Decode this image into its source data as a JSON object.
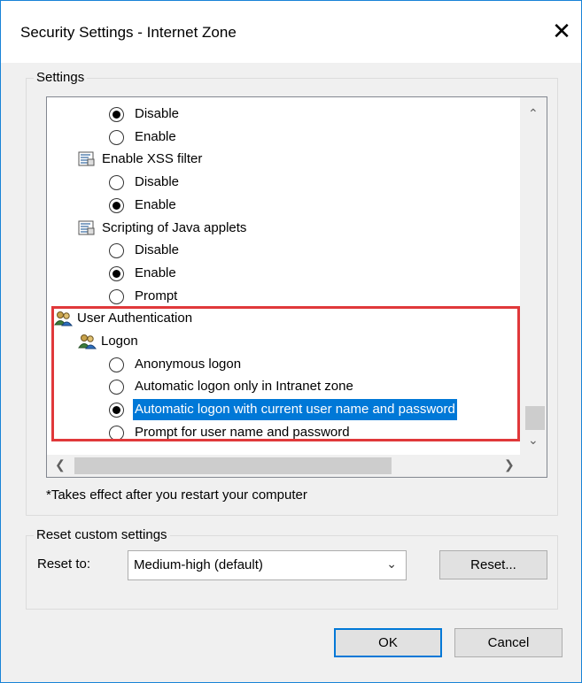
{
  "window": {
    "title": "Security Settings - Internet Zone",
    "close_glyph": "✕"
  },
  "settings_group": {
    "legend": "Settings",
    "rows": [
      {
        "kind": "radio",
        "label": "Disable",
        "checked": true
      },
      {
        "kind": "radio",
        "label": "Enable",
        "checked": false
      },
      {
        "kind": "setting",
        "label": "Enable XSS filter",
        "icon": "script-setting-icon"
      },
      {
        "kind": "radio",
        "label": "Disable",
        "checked": false
      },
      {
        "kind": "radio",
        "label": "Enable",
        "checked": true
      },
      {
        "kind": "setting",
        "label": "Scripting of Java applets",
        "icon": "script-setting-icon"
      },
      {
        "kind": "radio",
        "label": "Disable",
        "checked": false
      },
      {
        "kind": "radio",
        "label": "Enable",
        "checked": true
      },
      {
        "kind": "radio",
        "label": "Prompt",
        "checked": false
      },
      {
        "kind": "category",
        "label": "User Authentication",
        "icon": "users-icon"
      },
      {
        "kind": "subcategory",
        "label": "Logon",
        "icon": "users-icon"
      },
      {
        "kind": "radio",
        "label": "Anonymous logon",
        "checked": false
      },
      {
        "kind": "radio",
        "label": "Automatic logon only in Intranet zone",
        "checked": false
      },
      {
        "kind": "radio",
        "label": "Automatic logon with current user name and password",
        "checked": true,
        "selected": true
      },
      {
        "kind": "radio",
        "label": "Prompt for user name and password",
        "checked": false
      }
    ],
    "note": "*Takes effect after you restart your computer"
  },
  "reset_group": {
    "legend": "Reset custom settings",
    "reset_to_label": "Reset to:",
    "reset_to_value": "Medium-high (default)",
    "reset_button": "Reset..."
  },
  "footer": {
    "ok_label": "OK",
    "cancel_label": "Cancel"
  },
  "colors": {
    "selection": "#0078d7",
    "highlight_box": "#e0383a",
    "dialog_bg": "#f0f0f0"
  }
}
